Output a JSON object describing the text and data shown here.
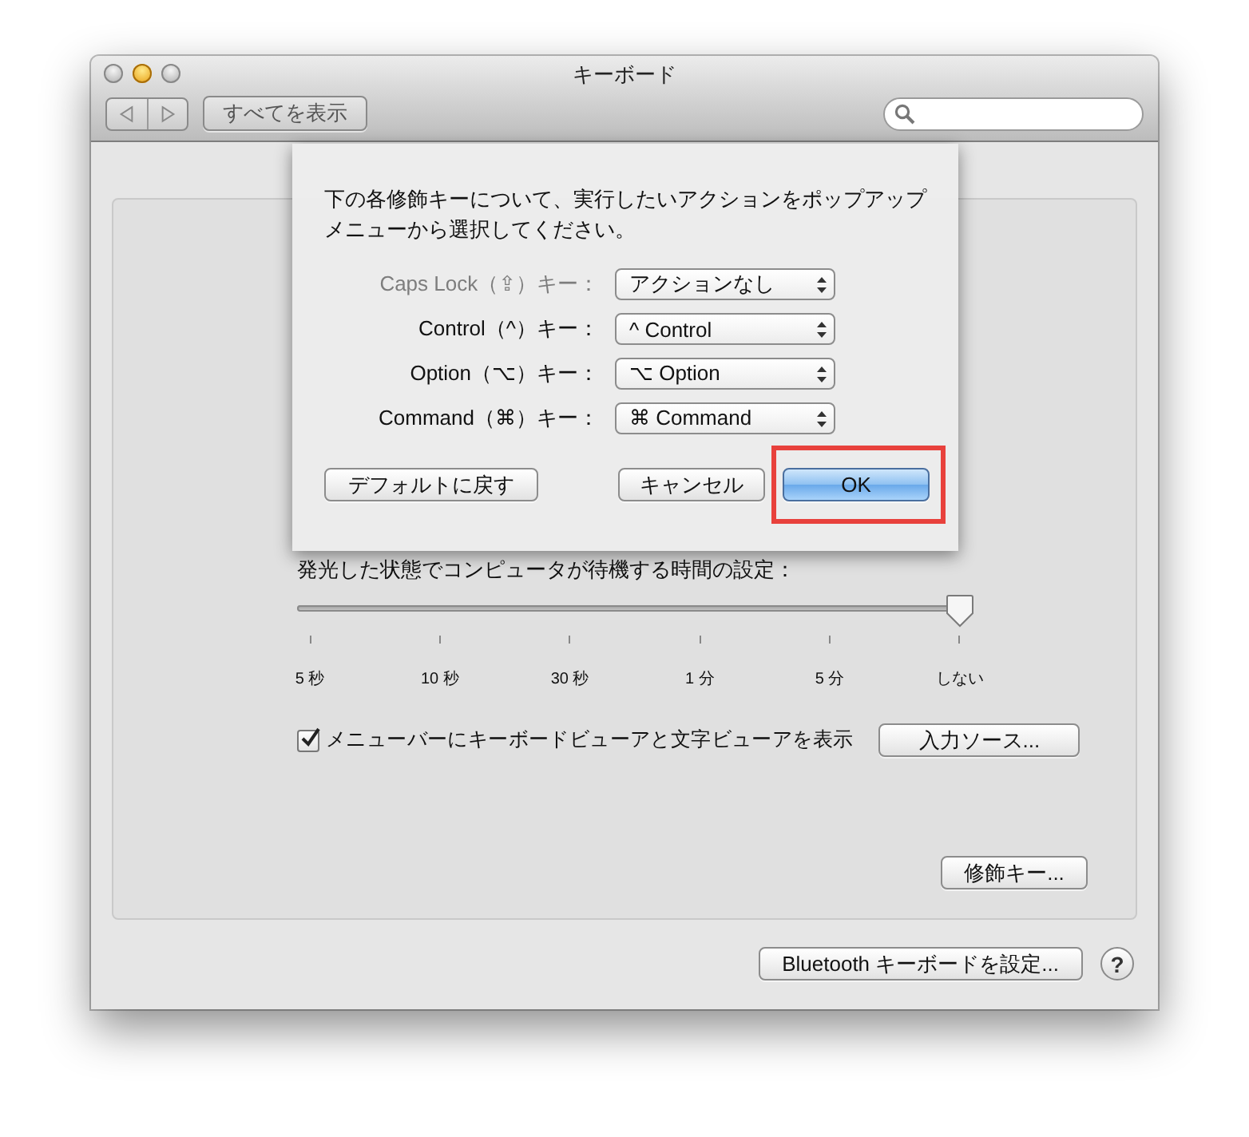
{
  "window": {
    "title": "キーボード"
  },
  "toolbar": {
    "show_all": "すべてを表示"
  },
  "sheet": {
    "message": "下の各修飾キーについて、実行したいアクションをポップアップメニューから選択してください。",
    "rows": [
      {
        "label": "Caps Lock（⇪）キー：",
        "value": "アクションなし",
        "disabled": true
      },
      {
        "label": "Control（^）キー：",
        "value": "^ Control",
        "disabled": false
      },
      {
        "label": "Option（⌥）キー：",
        "value": "⌥ Option",
        "disabled": false
      },
      {
        "label": "Command（⌘）キー：",
        "value": "⌘ Command",
        "disabled": false
      }
    ],
    "buttons": [
      {
        "label": "デフォルトに戻す",
        "kind": "plain",
        "highlighted": false
      },
      {
        "label": "キャンセル",
        "kind": "plain",
        "highlighted": false
      },
      {
        "label": "OK",
        "kind": "default",
        "highlighted": true
      }
    ]
  },
  "backlight": {
    "label": "発光した状態でコンピュータが待機する時間の設定：",
    "level": 1,
    "ticks": [
      "5 秒",
      "10 秒",
      "30 秒",
      "1 分",
      "5 分",
      "しない"
    ]
  },
  "viewer_checkbox": {
    "label": "メニューバーにキーボードビューアと文字ビューアを表示",
    "checked": true
  },
  "input_sources_button": "入力ソース...",
  "modifier_keys_button": "修飾キー...",
  "bluetooth_button": "Bluetooth キーボードを設定...",
  "help_button": "?"
}
